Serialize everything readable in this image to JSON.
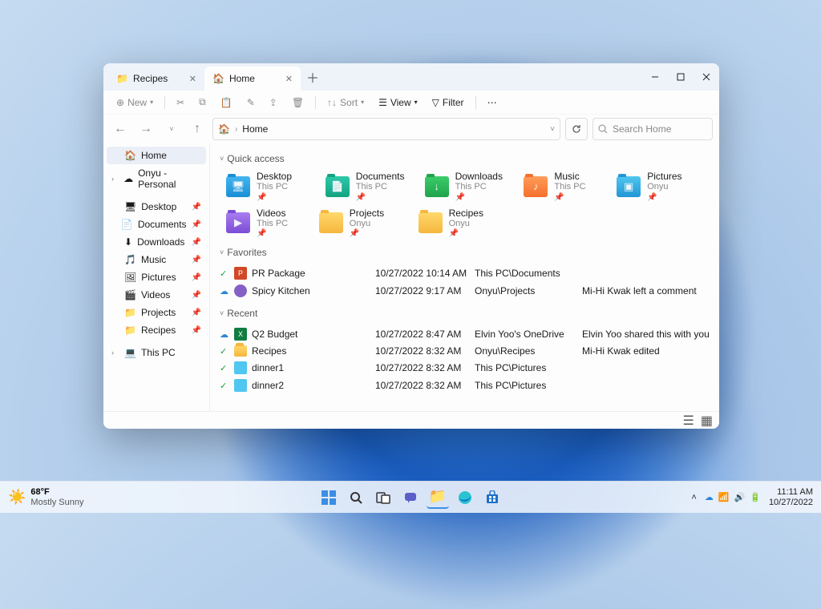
{
  "tabs": [
    {
      "label": "Recipes",
      "active": false
    },
    {
      "label": "Home",
      "active": true
    }
  ],
  "toolbar": {
    "new": "New",
    "sort": "Sort",
    "view": "View",
    "filter": "Filter"
  },
  "breadcrumb": {
    "root": "Home"
  },
  "search": {
    "placeholder": "Search Home"
  },
  "sidebar": {
    "top": [
      {
        "label": "Home",
        "icon": "home",
        "active": true
      },
      {
        "label": "Onyu - Personal",
        "icon": "onedrive",
        "expandable": true
      }
    ],
    "pinned": [
      {
        "label": "Desktop",
        "icon": "desktop"
      },
      {
        "label": "Documents",
        "icon": "documents"
      },
      {
        "label": "Downloads",
        "icon": "downloads"
      },
      {
        "label": "Music",
        "icon": "music"
      },
      {
        "label": "Pictures",
        "icon": "pictures"
      },
      {
        "label": "Videos",
        "icon": "videos"
      },
      {
        "label": "Projects",
        "icon": "folder"
      },
      {
        "label": "Recipes",
        "icon": "folder"
      }
    ],
    "bottom": [
      {
        "label": "This PC",
        "icon": "pc",
        "expandable": true
      }
    ]
  },
  "sections": {
    "quick": "Quick access",
    "favorites": "Favorites",
    "recent": "Recent"
  },
  "quick_access": [
    {
      "name": "Desktop",
      "sub": "This PC",
      "color": "blue",
      "glyph": "🖥"
    },
    {
      "name": "Documents",
      "sub": "This PC",
      "color": "teal",
      "glyph": "📄"
    },
    {
      "name": "Downloads",
      "sub": "This PC",
      "color": "green",
      "glyph": "↓"
    },
    {
      "name": "Music",
      "sub": "This PC",
      "color": "orange",
      "glyph": "♪"
    },
    {
      "name": "Pictures",
      "sub": "Onyu",
      "color": "cyan",
      "glyph": "▣",
      "cloud": true
    },
    {
      "name": "Videos",
      "sub": "This PC",
      "color": "purple",
      "glyph": "▶"
    },
    {
      "name": "Projects",
      "sub": "Onyu",
      "color": "",
      "glyph": "",
      "cloud": true
    },
    {
      "name": "Recipes",
      "sub": "Onyu",
      "color": "",
      "glyph": "",
      "cloud": true
    }
  ],
  "favorites": [
    {
      "name": "PR Package",
      "date": "10/27/2022 10:14 AM",
      "loc": "This PC\\Documents",
      "note": "",
      "icon": "ppt",
      "status": "synced"
    },
    {
      "name": "Spicy Kitchen",
      "date": "10/27/2022 9:17 AM",
      "loc": "Onyu\\Projects",
      "note": "Mi-Hi Kwak left a comment",
      "icon": "loop",
      "status": "cloud"
    }
  ],
  "recent": [
    {
      "name": "Q2 Budget",
      "date": "10/27/2022 8:47 AM",
      "loc": "Elvin Yoo's OneDrive",
      "note": "Elvin Yoo shared this with you",
      "icon": "xls",
      "status": "cloud"
    },
    {
      "name": "Recipes",
      "date": "10/27/2022 8:32 AM",
      "loc": "Onyu\\Recipes",
      "note": "Mi-Hi Kwak edited",
      "icon": "folder",
      "status": "synced"
    },
    {
      "name": "dinner1",
      "date": "10/27/2022 8:32 AM",
      "loc": "This PC\\Pictures",
      "note": "",
      "icon": "image",
      "status": "synced"
    },
    {
      "name": "dinner2",
      "date": "10/27/2022 8:32 AM",
      "loc": "This PC\\Pictures",
      "note": "",
      "icon": "image",
      "status": "synced"
    }
  ],
  "taskbar": {
    "weather_temp": "68°F",
    "weather_desc": "Mostly Sunny",
    "time": "11:11 AM",
    "date": "10/27/2022"
  }
}
